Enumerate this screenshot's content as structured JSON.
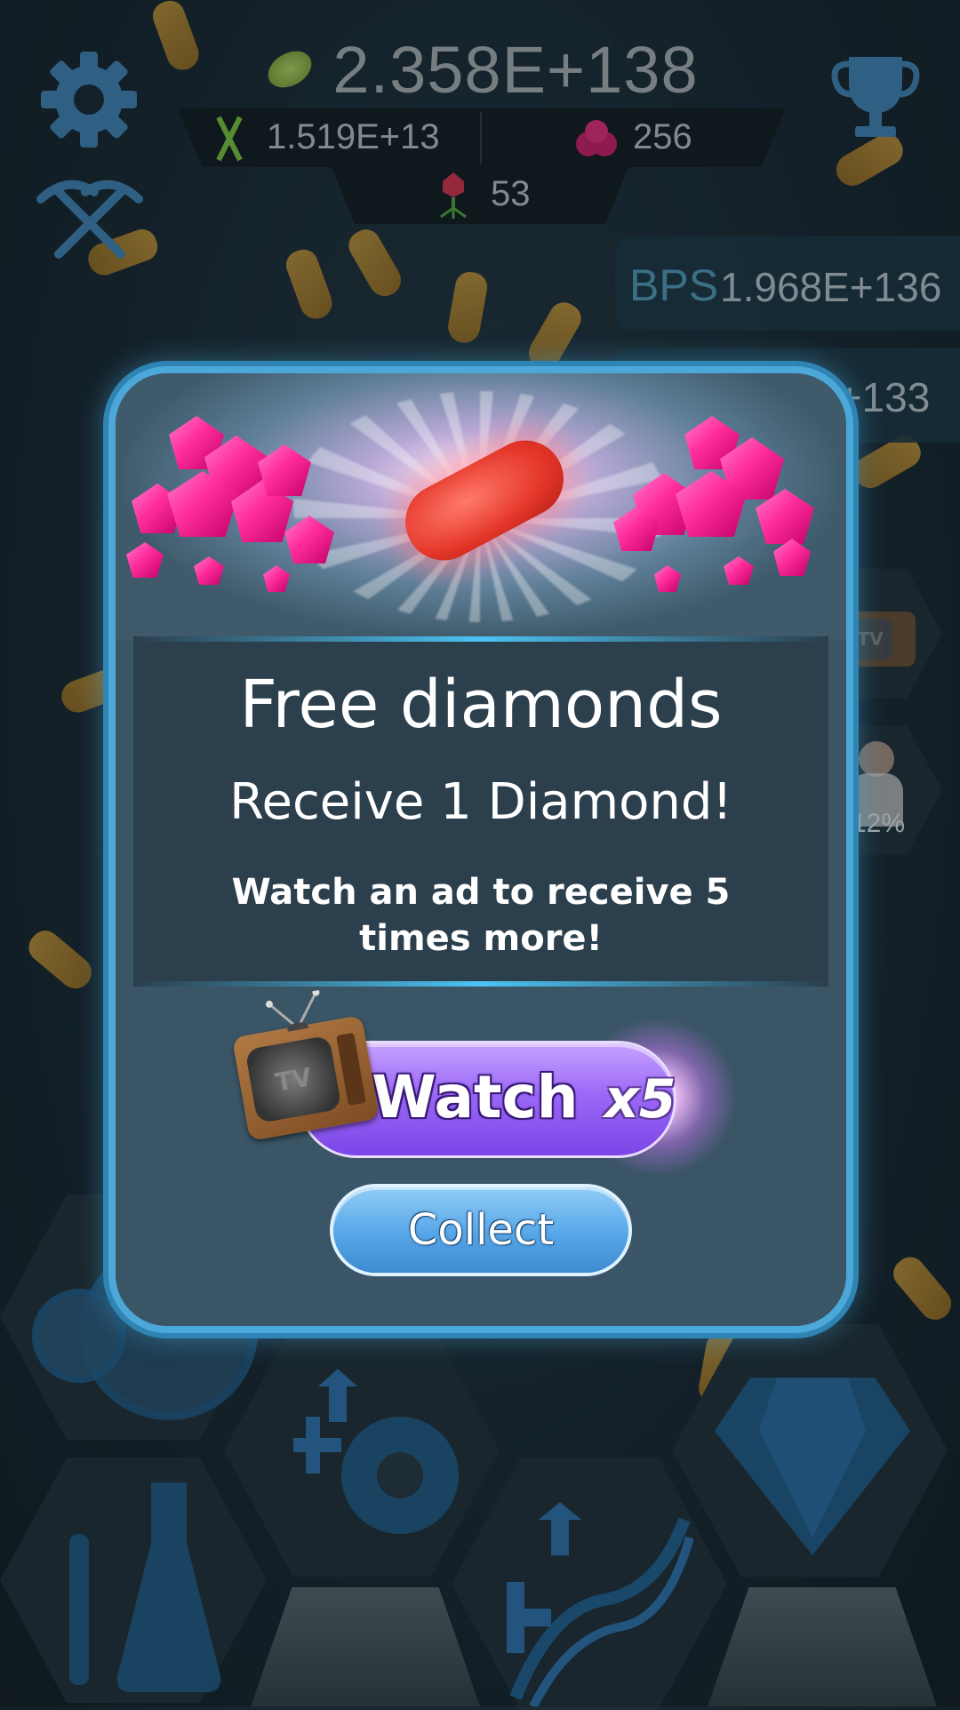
{
  "hud": {
    "main_count": "2.358E+138",
    "dna_count": "1.519E+13",
    "cells_count": "256",
    "phage_count": "53",
    "bps_label": "BPS",
    "bps_value": "1.968E+136",
    "second_panel_value": "E+133",
    "scientist_percent": "12%"
  },
  "icons": {
    "settings": "gear-icon",
    "tools": "pickaxe-icon",
    "trophy": "trophy-icon",
    "tv": "tv-icon"
  },
  "modal": {
    "title": "Free diamonds",
    "subtitle": "Receive 1 Diamond!",
    "description": "Watch an ad to receive 5 times more!",
    "watch_label": "Watch",
    "watch_multiplier": "x5",
    "tv_label": "TV",
    "collect_label": "Collect"
  },
  "colors": {
    "accent_blue": "#4ba8d8",
    "watch_purple": "#9b69f7",
    "collect_blue": "#57a6e8",
    "gem_pink": "#ff2d9b"
  }
}
